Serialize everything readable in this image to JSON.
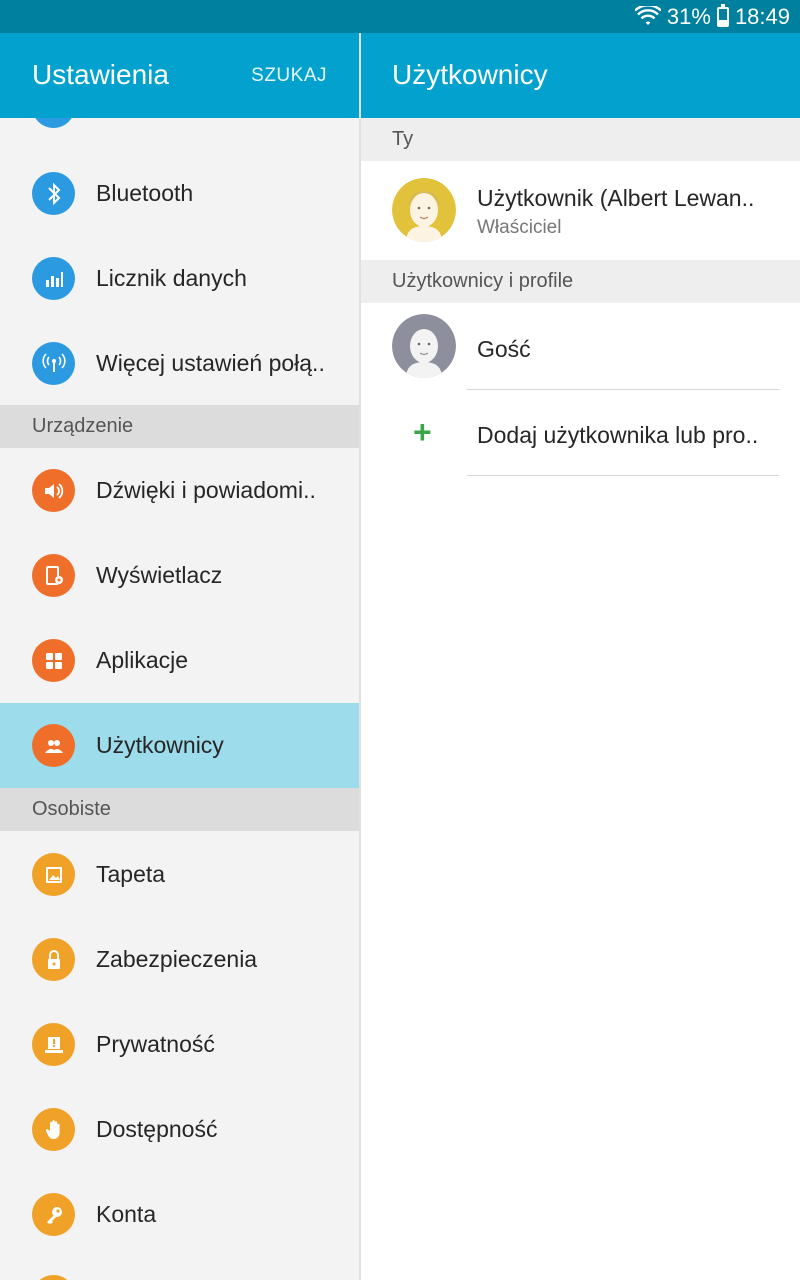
{
  "status_bar": {
    "battery": "31%",
    "battery_level": 0.31,
    "time": "18:49",
    "icons": [
      "wifi-icon",
      "battery-icon"
    ],
    "color": "#00809f"
  },
  "left_pane": {
    "title": "Ustawienia",
    "search_label": "SZUKAJ",
    "items_top": [
      {
        "label": "Bluetooth",
        "icon": "bluetooth-icon"
      },
      {
        "label": "Licznik danych",
        "icon": "data-usage-icon"
      },
      {
        "label": "Więcej ustawień połą..",
        "icon": "more-connections-icon"
      }
    ],
    "section_device": "Urządzenie",
    "items_device": [
      {
        "label": "Dźwięki i powiadomi..",
        "icon": "sound-icon"
      },
      {
        "label": "Wyświetlacz",
        "icon": "display-icon"
      },
      {
        "label": "Aplikacje",
        "icon": "apps-icon"
      },
      {
        "label": "Użytkownicy",
        "icon": "users-icon",
        "selected": true
      }
    ],
    "section_personal": "Osobiste",
    "items_personal": [
      {
        "label": "Tapeta",
        "icon": "wallpaper-icon"
      },
      {
        "label": "Zabezpieczenia",
        "icon": "lock-icon"
      },
      {
        "label": "Prywatność",
        "icon": "privacy-icon"
      },
      {
        "label": "Dostępność",
        "icon": "accessibility-hand-icon"
      },
      {
        "label": "Konta",
        "icon": "key-icon"
      }
    ],
    "colors": {
      "header": "#03a2ce",
      "selected": "#9ddcea",
      "blue": "#2c9ae0",
      "orange": "#ef6f2a",
      "amber": "#efa128"
    }
  },
  "right_pane": {
    "title": "Użytkownicy",
    "section_you": "Ty",
    "owner": {
      "name": "Użytkownik (Albert Lewan..",
      "role": "Właściciel"
    },
    "section_users": "Użytkownicy i profile",
    "guest": {
      "name": "Gość"
    },
    "add_user": {
      "label": "Dodaj użytkownika lub pro..",
      "icon": "plus-icon"
    }
  }
}
